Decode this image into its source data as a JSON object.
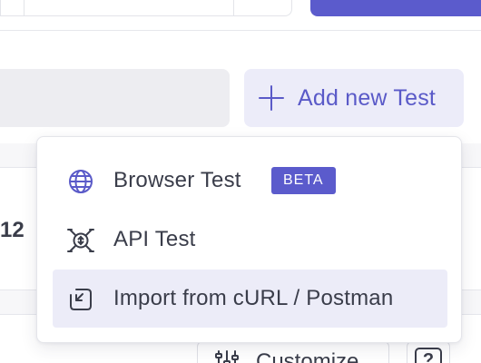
{
  "toolbar": {
    "add_button_label": "Add new Test"
  },
  "menu": {
    "items": [
      {
        "label": "Browser Test",
        "icon": "globe-icon",
        "badge": "BETA"
      },
      {
        "label": "API Test",
        "icon": "api-icon"
      },
      {
        "label": "Import from cURL / Postman",
        "icon": "import-icon"
      }
    ]
  },
  "background": {
    "partial_text": "12",
    "customize_label": "Customize",
    "help_label": "?"
  },
  "colors": {
    "accent": "#5b5bcc",
    "accent_light": "#ececf9",
    "text": "#3a3d4a",
    "active_item_bg": "#ececf8"
  }
}
